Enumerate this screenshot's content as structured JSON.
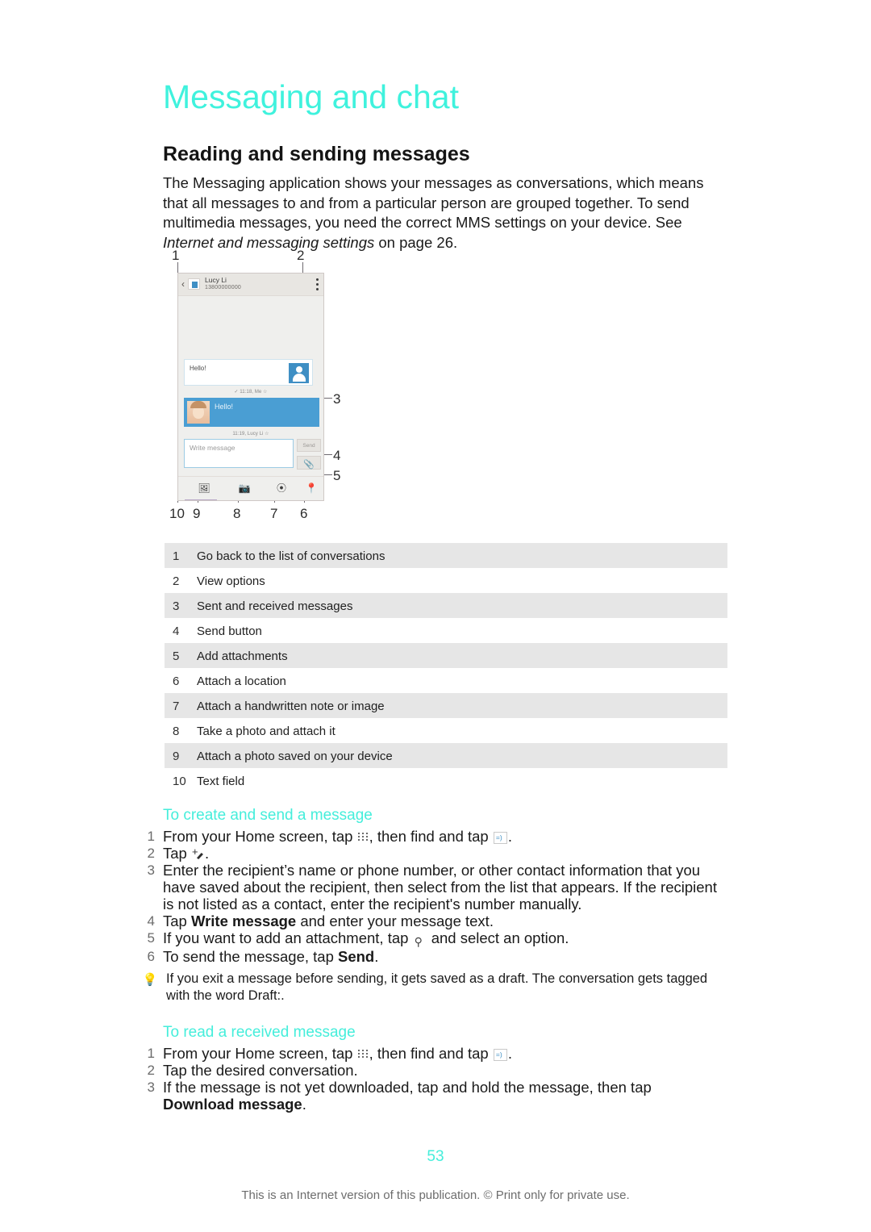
{
  "document": {
    "chapter_title": "Messaging and chat",
    "section_title": "Reading and sending messages",
    "intro_part1": "The Messaging application shows your messages as conversations, which means that all messages to and from a particular person are grouped together. To send multimedia messages, you need the correct MMS settings on your device. See ",
    "intro_italic": "Internet and messaging settings",
    "intro_part2": " on page 26.",
    "page_number": "53",
    "footer_note": "This is an Internet version of this publication. © Print only for private use."
  },
  "figure": {
    "callouts": [
      "1",
      "2",
      "3",
      "4",
      "5",
      "6",
      "7",
      "8",
      "9",
      "10"
    ],
    "phone": {
      "contact_name": "Lucy Li",
      "contact_number": "13800000000",
      "incoming_message": "Hello!",
      "incoming_meta": "✓ 11:18, Me  ☆",
      "outgoing_message": "Hello!",
      "outgoing_meta": "11:19, Lucy Li  ☆",
      "write_placeholder": "Write message",
      "send_label": "Send",
      "attach_icon": "paperclip-icon",
      "toolbar_icons": [
        "image-icon",
        "camera-icon",
        "handwriting-icon",
        "location-pin-icon"
      ]
    }
  },
  "legend": {
    "rows": [
      {
        "num": "1",
        "label": "Go back to the list of conversations"
      },
      {
        "num": "2",
        "label": "View options"
      },
      {
        "num": "3",
        "label": "Sent and received messages"
      },
      {
        "num": "4",
        "label": "Send button"
      },
      {
        "num": "5",
        "label": "Add attachments"
      },
      {
        "num": "6",
        "label": "Attach a location"
      },
      {
        "num": "7",
        "label": "Attach a handwritten note or image"
      },
      {
        "num": "8",
        "label": "Take a photo and attach it"
      },
      {
        "num": "9",
        "label": "Attach a photo saved on your device"
      },
      {
        "num": "10",
        "label": "Text field"
      }
    ]
  },
  "procedure_create": {
    "title": "To create and send a message",
    "step1_a": "From your Home screen, tap ",
    "step1_b": ", then find and tap ",
    "step1_c": ".",
    "step2_a": "Tap ",
    "step2_b": ".",
    "step3": "Enter the recipient’s name or phone number, or other contact information that you have saved about the recipient, then select from the list that appears. If the recipient is not listed as a contact, enter the recipient's number manually.",
    "step4_a": "Tap ",
    "step4_bold": "Write message",
    "step4_b": " and enter your message text.",
    "step5_a": "If you want to add an attachment, tap ",
    "step5_b": " and select an option.",
    "step6_a": "To send the message, tap ",
    "step6_bold": "Send",
    "step6_b": ".",
    "numbers": [
      "1",
      "2",
      "3",
      "4",
      "5",
      "6"
    ]
  },
  "tip": {
    "icon": "lightbulb-icon",
    "text": "If you exit a message before sending, it gets saved as a draft. The conversation gets tagged with the word Draft:."
  },
  "procedure_read": {
    "title": "To read a received message",
    "step1_a": "From your Home screen, tap ",
    "step1_b": ", then find and tap ",
    "step1_c": ".",
    "step2": "Tap the desired conversation.",
    "step3_a": "If the message is not yet downloaded, tap and hold the message, then tap ",
    "step3_bold": "Download message",
    "step3_b": ".",
    "numbers": [
      "1",
      "2",
      "3"
    ]
  },
  "colors": {
    "accent_cyan": "#3ff2dd",
    "heading_cyan": "#45eedb",
    "bubble_blue": "#4a9ed3",
    "row_gray": "#e6e6e6",
    "text_black": "#1a1a1a",
    "footer_gray": "#6d6d6d"
  }
}
